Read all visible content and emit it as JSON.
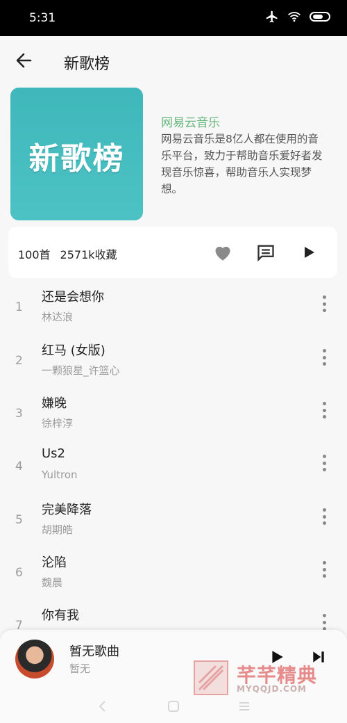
{
  "status": {
    "time": "5:31"
  },
  "header": {
    "title": "新歌榜"
  },
  "cover": {
    "text": "新歌榜"
  },
  "info": {
    "brand": "网易云音乐",
    "description": "网易云音乐是8亿人都在使用的音乐平台，致力于帮助音乐爱好者发现音乐惊喜，帮助音乐人实现梦想。"
  },
  "stats": {
    "count": "100首",
    "favorites": "2571k收藏"
  },
  "songs": [
    {
      "num": "1",
      "name": "还是会想你",
      "artist": "林达浪"
    },
    {
      "num": "2",
      "name": "红马 (女版)",
      "artist": "一颗狼星_许篮心"
    },
    {
      "num": "3",
      "name": "嫌晚",
      "artist": "徐梓淳"
    },
    {
      "num": "4",
      "name": "Us2",
      "artist": "Yultron"
    },
    {
      "num": "5",
      "name": "完美降落",
      "artist": "胡期皓"
    },
    {
      "num": "6",
      "name": "沦陷",
      "artist": "魏晨"
    },
    {
      "num": "7",
      "name": "你有我",
      "artist": ""
    }
  ],
  "player": {
    "title": "暂无歌曲",
    "artist": "暂无"
  },
  "watermark": {
    "cn": "芊芊精典",
    "en": "MYQQJD.COM"
  },
  "colors": {
    "brand": "#64b67b",
    "cover": "#43bcbf"
  },
  "icons": [
    "back-arrow-icon",
    "airplane-icon",
    "wifi-icon",
    "battery-icon",
    "heart-icon",
    "comment-icon",
    "play-icon",
    "more-vertical-icon",
    "skip-next-icon"
  ]
}
